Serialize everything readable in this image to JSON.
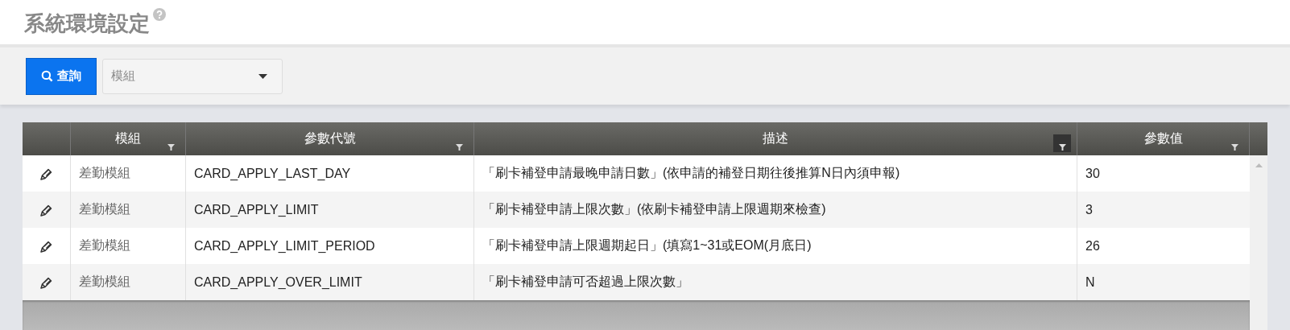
{
  "page": {
    "title": "系統環境設定"
  },
  "toolbar": {
    "search_button": "查詢",
    "module_select": {
      "placeholder": "模組"
    }
  },
  "table": {
    "columns": [
      {
        "label": "模組",
        "filtered": false
      },
      {
        "label": "參數代號",
        "filtered": false
      },
      {
        "label": "描述",
        "filtered": true
      },
      {
        "label": "參數值",
        "filtered": false
      }
    ],
    "rows": [
      {
        "module": "差勤模組",
        "code": "CARD_APPLY_LAST_DAY",
        "description": "「刷卡補登申請最晚申請日數」(依申請的補登日期往後推算N日內須申報)",
        "value": "30"
      },
      {
        "module": "差勤模組",
        "code": "CARD_APPLY_LIMIT",
        "description": "「刷卡補登申請上限次數」(依刷卡補登申請上限週期來檢查)",
        "value": "3"
      },
      {
        "module": "差勤模組",
        "code": "CARD_APPLY_LIMIT_PERIOD",
        "description": "「刷卡補登申請上限週期起日」(填寫1~31或EOM(月底日)",
        "value": "26"
      },
      {
        "module": "差勤模組",
        "code": "CARD_APPLY_OVER_LIMIT",
        "description": "「刷卡補登申請可否超過上限次數」",
        "value": "N"
      }
    ]
  }
}
